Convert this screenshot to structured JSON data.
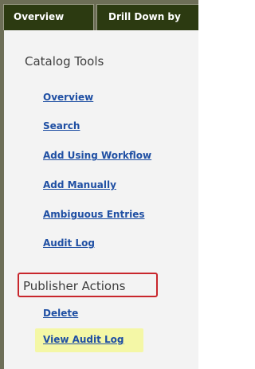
{
  "tabs": [
    {
      "label": "Overview"
    },
    {
      "label": "Drill Down by"
    }
  ],
  "catalog_tools": {
    "heading": "Catalog Tools",
    "links": [
      {
        "label": "Overview"
      },
      {
        "label": "Search"
      },
      {
        "label": "Add Using Workflow"
      },
      {
        "label": "Add Manually"
      },
      {
        "label": "Ambiguous Entries"
      },
      {
        "label": "Audit Log"
      }
    ]
  },
  "publisher_actions": {
    "heading": "Publisher Actions",
    "links": [
      {
        "label": "Delete"
      },
      {
        "label": "View Audit Log",
        "highlighted": true
      }
    ]
  },
  "colors": {
    "tab_background": "#2c3a11",
    "frame": "#6d6e57",
    "link": "#1f4fa3",
    "annotation_box": "#c8262c",
    "link_highlight": "#f4f7a6"
  }
}
